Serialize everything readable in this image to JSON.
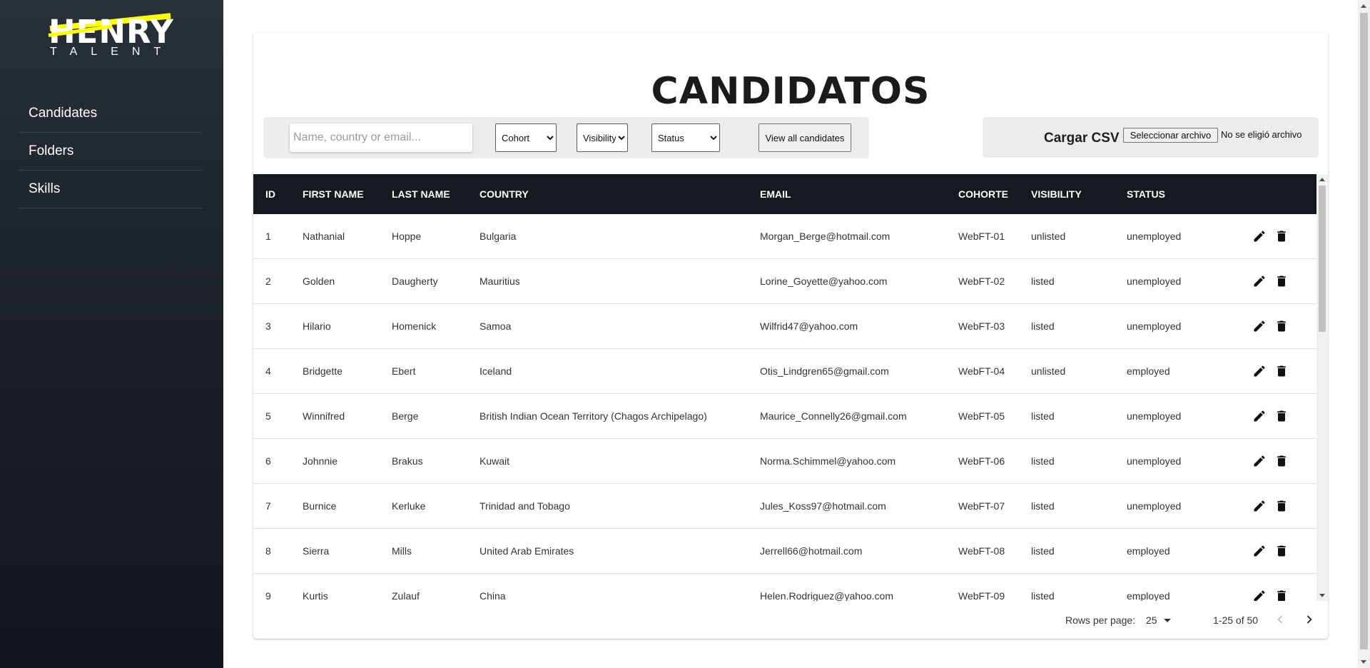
{
  "logo": {
    "word": "HENRY",
    "sub": "TALENT"
  },
  "sidebar": {
    "items": [
      {
        "label": "Candidates"
      },
      {
        "label": "Folders"
      },
      {
        "label": "Skills"
      }
    ]
  },
  "page": {
    "title": "CANDIDATOS"
  },
  "filters": {
    "search_placeholder": "Name, country or email...",
    "cohort": "Cohort",
    "visibility": "Visibility",
    "status": "Status",
    "view_all": "View all candidates"
  },
  "csv": {
    "label": "Cargar CSV",
    "button": "Seleccionar archivo",
    "no_file": "No se eligió archivo"
  },
  "table": {
    "headers": {
      "id": "ID",
      "first": "FIRST NAME",
      "last": "LAST NAME",
      "country": "COUNTRY",
      "email": "EMAIL",
      "cohort": "COHORTE",
      "visibility": "VISIBILITY",
      "status": "STATUS"
    },
    "rows": [
      {
        "id": "1",
        "first": "Nathanial",
        "last": "Hoppe",
        "country": "Bulgaria",
        "email": "Morgan_Berge@hotmail.com",
        "cohort": "WebFT-01",
        "visibility": "unlisted",
        "status": "unemployed"
      },
      {
        "id": "2",
        "first": "Golden",
        "last": "Daugherty",
        "country": "Mauritius",
        "email": "Lorine_Goyette@yahoo.com",
        "cohort": "WebFT-02",
        "visibility": "listed",
        "status": "unemployed"
      },
      {
        "id": "3",
        "first": "Hilario",
        "last": "Homenick",
        "country": "Samoa",
        "email": "Wilfrid47@yahoo.com",
        "cohort": "WebFT-03",
        "visibility": "listed",
        "status": "unemployed"
      },
      {
        "id": "4",
        "first": "Bridgette",
        "last": "Ebert",
        "country": "Iceland",
        "email": "Otis_Lindgren65@gmail.com",
        "cohort": "WebFT-04",
        "visibility": "unlisted",
        "status": "employed"
      },
      {
        "id": "5",
        "first": "Winnifred",
        "last": "Berge",
        "country": "British Indian Ocean Territory (Chagos Archipelago)",
        "email": "Maurice_Connelly26@gmail.com",
        "cohort": "WebFT-05",
        "visibility": "listed",
        "status": "unemployed"
      },
      {
        "id": "6",
        "first": "Johnnie",
        "last": "Brakus",
        "country": "Kuwait",
        "email": "Norma.Schimmel@yahoo.com",
        "cohort": "WebFT-06",
        "visibility": "listed",
        "status": "unemployed"
      },
      {
        "id": "7",
        "first": "Burnice",
        "last": "Kerluke",
        "country": "Trinidad and Tobago",
        "email": "Jules_Koss97@hotmail.com",
        "cohort": "WebFT-07",
        "visibility": "listed",
        "status": "unemployed"
      },
      {
        "id": "8",
        "first": "Sierra",
        "last": "Mills",
        "country": "United Arab Emirates",
        "email": "Jerrell66@hotmail.com",
        "cohort": "WebFT-08",
        "visibility": "listed",
        "status": "employed"
      },
      {
        "id": "9",
        "first": "Kurtis",
        "last": "Zulauf",
        "country": "China",
        "email": "Helen.Rodriguez@yahoo.com",
        "cohort": "WebFT-09",
        "visibility": "listed",
        "status": "employed"
      }
    ]
  },
  "pagination": {
    "rows_per_page_label": "Rows per page:",
    "rows_per_page": "25",
    "range": "1-25 of 50"
  },
  "icons": {
    "edit": "pencil-icon",
    "delete": "trash-icon",
    "prev": "chevron-left-icon",
    "next": "chevron-right-icon"
  },
  "colors": {
    "sidebar": "#1a1f26",
    "accent": "#ffff01",
    "table_header": "#151a21"
  }
}
